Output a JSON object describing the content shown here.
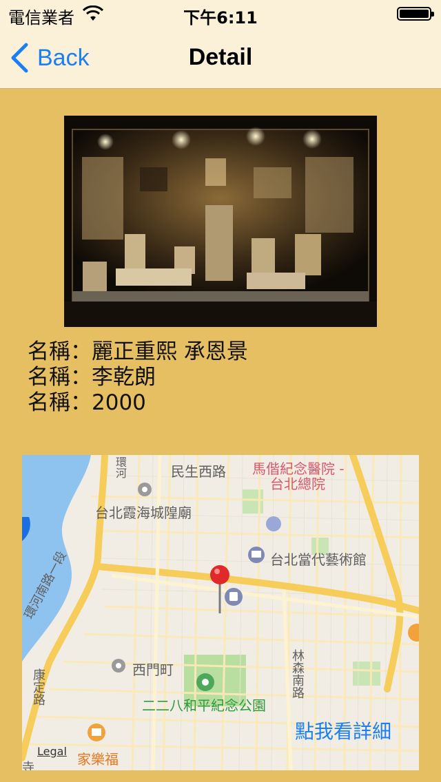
{
  "status_bar": {
    "carrier": "電信業者",
    "time": "下午6:11"
  },
  "nav": {
    "back_label": "Back",
    "title": "Detail"
  },
  "info": {
    "line1": "名稱：麗正重熙 承恩景",
    "line2": "名稱：李乾朗",
    "line3": "名稱：2000"
  },
  "map": {
    "labels": {
      "minsheng": "民生西路",
      "huanhe_n": "環河",
      "mackay_1": "馬偕紀念醫院 -",
      "mackay_2": "台北總院",
      "temple": "台北霞海城隍廟",
      "moca": "台北當代藝術館",
      "huanhe_s": "環河南路一段",
      "ximending": "西門町",
      "kangding": "康定路",
      "linsen": "林森南路",
      "park": "二二八和平紀念公園",
      "carrefour": "家樂福",
      "temple2": "寺"
    },
    "legal": "Legal",
    "detail_link": "點我看詳細"
  }
}
